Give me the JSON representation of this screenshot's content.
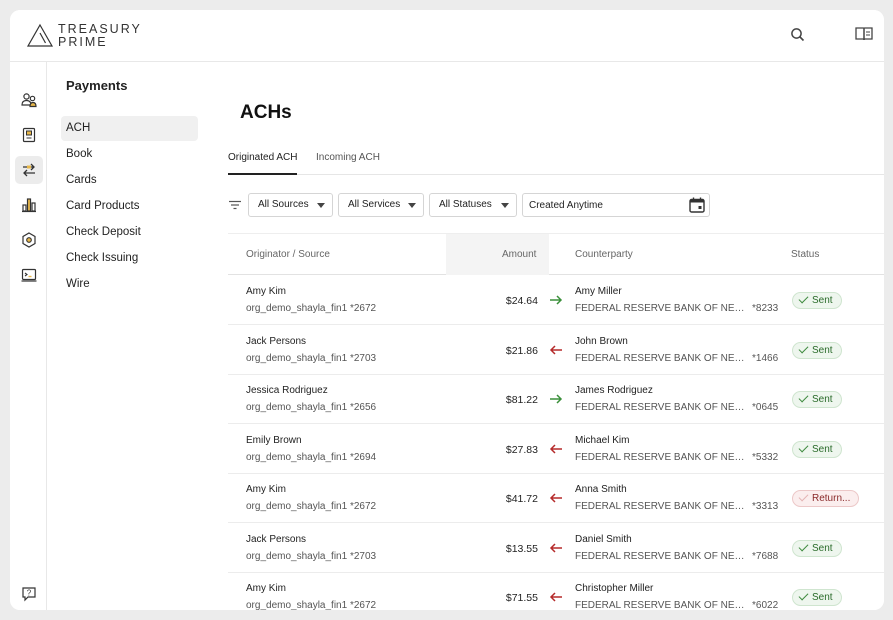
{
  "brand": {
    "line1": "TREASURY",
    "line2": "PRIME"
  },
  "topbar": {
    "icons": [
      "search-icon",
      "book-icon"
    ]
  },
  "rail": {
    "icons": [
      "users-icon",
      "ledger-icon",
      "transfer-icon",
      "bar-chart-icon",
      "settings-icon",
      "terminal-icon",
      "help-chat-icon"
    ]
  },
  "subnav": {
    "title": "Payments",
    "items": [
      {
        "label": "ACH",
        "active": true
      },
      {
        "label": "Book"
      },
      {
        "label": "Cards"
      },
      {
        "label": "Card Products"
      },
      {
        "label": "Check Deposit"
      },
      {
        "label": "Check Issuing"
      },
      {
        "label": "Wire"
      }
    ]
  },
  "page": {
    "title": "ACHs"
  },
  "tabs": [
    {
      "label": "Originated ACH",
      "active": true
    },
    {
      "label": "Incoming ACH"
    }
  ],
  "filters": {
    "sources": "All Sources",
    "services": "All Services",
    "statuses": "All Statuses",
    "created_value": "Created Anytime"
  },
  "table": {
    "headers": {
      "originator": "Originator / Source",
      "amount": "Amount",
      "counterparty": "Counterparty",
      "status": "Status"
    },
    "rows": [
      {
        "originator": "Amy Kim",
        "source": "org_demo_shayla_fin1 *2672",
        "amount": "$24.64",
        "direction": "outgoing",
        "counterparty": "Amy Miller",
        "bank": "FEDERAL RESERVE BANK OF NEW ...",
        "account": "*8233",
        "status": "Sent"
      },
      {
        "originator": "Jack Persons",
        "source": "org_demo_shayla_fin1 *2703",
        "amount": "$21.86",
        "direction": "incoming",
        "counterparty": "John Brown",
        "bank": "FEDERAL RESERVE BANK OF NEW ...",
        "account": "*1466",
        "status": "Sent"
      },
      {
        "originator": "Jessica Rodriguez",
        "source": "org_demo_shayla_fin1 *2656",
        "amount": "$81.22",
        "direction": "outgoing",
        "counterparty": "James Rodriguez",
        "bank": "FEDERAL RESERVE BANK OF NEW ...",
        "account": "*0645",
        "status": "Sent"
      },
      {
        "originator": "Emily Brown",
        "source": "org_demo_shayla_fin1 *2694",
        "amount": "$27.83",
        "direction": "incoming",
        "counterparty": "Michael Kim",
        "bank": "FEDERAL RESERVE BANK OF NEW ...",
        "account": "*5332",
        "status": "Sent"
      },
      {
        "originator": "Amy Kim",
        "source": "org_demo_shayla_fin1 *2672",
        "amount": "$41.72",
        "direction": "incoming",
        "counterparty": "Anna Smith",
        "bank": "FEDERAL RESERVE BANK OF NEW ...",
        "account": "*3313",
        "status": "Return..."
      },
      {
        "originator": "Jack Persons",
        "source": "org_demo_shayla_fin1 *2703",
        "amount": "$13.55",
        "direction": "incoming",
        "counterparty": "Daniel Smith",
        "bank": "FEDERAL RESERVE BANK OF NEW ...",
        "account": "*7688",
        "status": "Sent"
      },
      {
        "originator": "Amy Kim",
        "source": "org_demo_shayla_fin1 *2672",
        "amount": "$71.55",
        "direction": "incoming",
        "counterparty": "Christopher Miller",
        "bank": "FEDERAL RESERVE BANK OF NEW ...",
        "account": "*6022",
        "status": "Sent"
      }
    ]
  },
  "colors": {
    "arrow_out": "#3a8f3a",
    "arrow_in": "#b52a2a",
    "active_bg": "#ececec"
  }
}
